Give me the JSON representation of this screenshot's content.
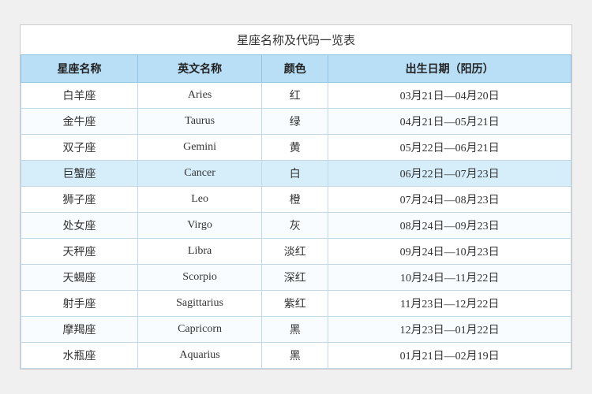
{
  "title": "星座名称及代码一览表",
  "headers": [
    "星座名称",
    "英文名称",
    "颜色",
    "出生日期（阳历）"
  ],
  "rows": [
    {
      "chinese": "白羊座",
      "english": "Aries",
      "color": "红",
      "dates": "03月21日—04月20日"
    },
    {
      "chinese": "金牛座",
      "english": "Taurus",
      "color": "绿",
      "dates": "04月21日—05月21日"
    },
    {
      "chinese": "双子座",
      "english": "Gemini",
      "color": "黄",
      "dates": "05月22日—06月21日"
    },
    {
      "chinese": "巨蟹座",
      "english": "Cancer",
      "color": "白",
      "dates": "06月22日—07月23日",
      "highlight": true
    },
    {
      "chinese": "狮子座",
      "english": "Leo",
      "color": "橙",
      "dates": "07月24日—08月23日"
    },
    {
      "chinese": "处女座",
      "english": "Virgo",
      "color": "灰",
      "dates": "08月24日—09月23日"
    },
    {
      "chinese": "天秤座",
      "english": "Libra",
      "color": "淡红",
      "dates": "09月24日—10月23日"
    },
    {
      "chinese": "天蝎座",
      "english": "Scorpio",
      "color": "深红",
      "dates": "10月24日—11月22日"
    },
    {
      "chinese": "射手座",
      "english": "Sagittarius",
      "color": "紫红",
      "dates": "11月23日—12月22日"
    },
    {
      "chinese": "摩羯座",
      "english": "Capricorn",
      "color": "黑",
      "dates": "12月23日—01月22日"
    },
    {
      "chinese": "水瓶座",
      "english": "Aquarius",
      "color": "黑",
      "dates": "01月21日—02月19日"
    }
  ]
}
